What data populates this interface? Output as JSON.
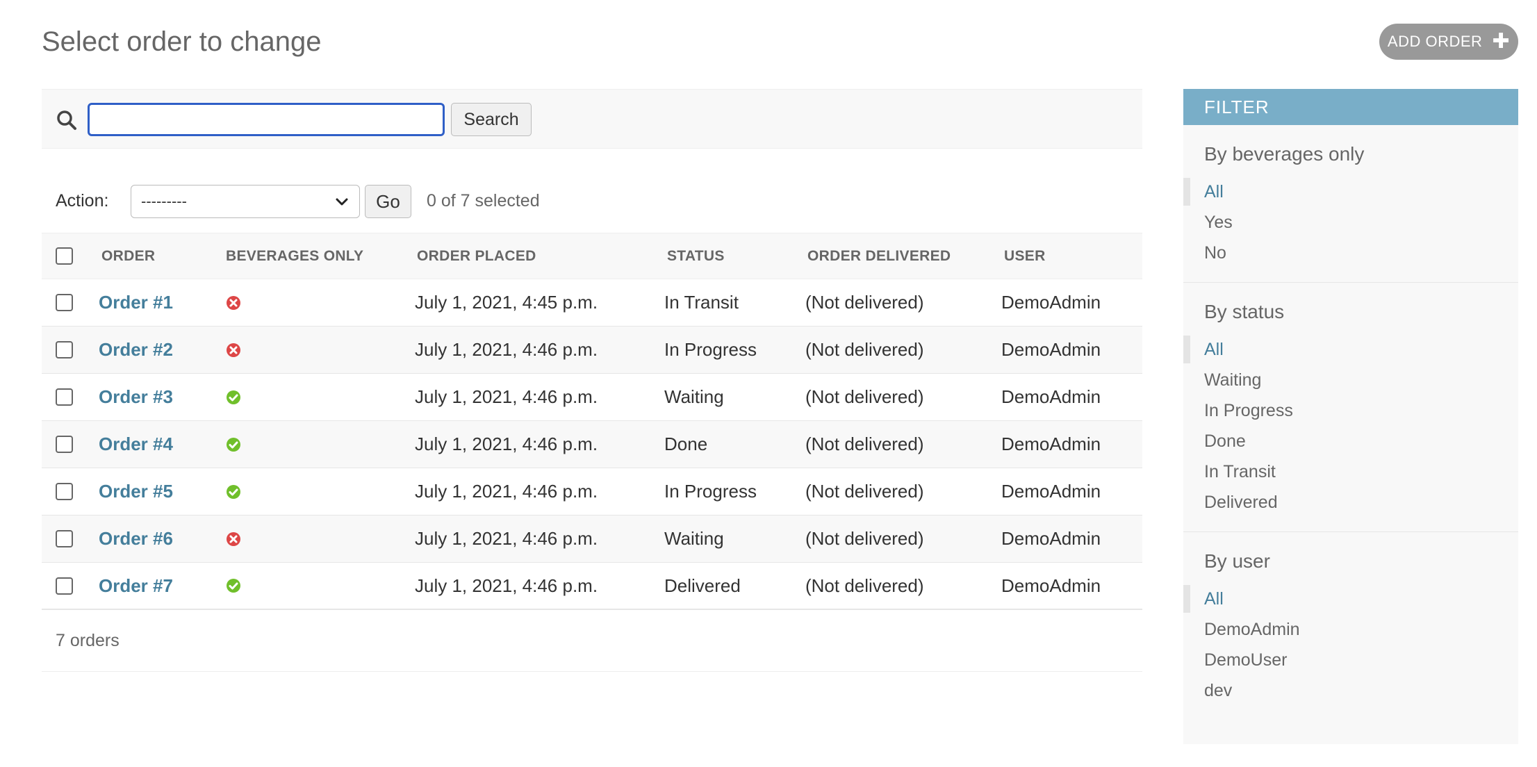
{
  "page": {
    "title": "Select order to change",
    "add_button_label": "ADD ORDER",
    "add_icon": "plus-icon"
  },
  "search": {
    "value": "",
    "placeholder": "",
    "button_label": "Search",
    "icon": "search-icon"
  },
  "actions": {
    "label": "Action:",
    "selected_option": "---------",
    "go_label": "Go",
    "counter": "0 of 7 selected"
  },
  "table": {
    "headers": {
      "order": "ORDER",
      "beverages_only": "BEVERAGES ONLY",
      "order_placed": "ORDER PLACED",
      "status": "STATUS",
      "order_delivered": "ORDER DELIVERED",
      "user": "USER"
    },
    "rows": [
      {
        "order": "Order #1",
        "beverages_only": false,
        "order_placed": "July 1, 2021, 4:45 p.m.",
        "status": "In Transit",
        "order_delivered": "(Not delivered)",
        "user": "DemoAdmin"
      },
      {
        "order": "Order #2",
        "beverages_only": false,
        "order_placed": "July 1, 2021, 4:46 p.m.",
        "status": "In Progress",
        "order_delivered": "(Not delivered)",
        "user": "DemoAdmin"
      },
      {
        "order": "Order #3",
        "beverages_only": true,
        "order_placed": "July 1, 2021, 4:46 p.m.",
        "status": "Waiting",
        "order_delivered": "(Not delivered)",
        "user": "DemoAdmin"
      },
      {
        "order": "Order #4",
        "beverages_only": true,
        "order_placed": "July 1, 2021, 4:46 p.m.",
        "status": "Done",
        "order_delivered": "(Not delivered)",
        "user": "DemoAdmin"
      },
      {
        "order": "Order #5",
        "beverages_only": true,
        "order_placed": "July 1, 2021, 4:46 p.m.",
        "status": "In Progress",
        "order_delivered": "(Not delivered)",
        "user": "DemoAdmin"
      },
      {
        "order": "Order #6",
        "beverages_only": false,
        "order_placed": "July 1, 2021, 4:46 p.m.",
        "status": "Waiting",
        "order_delivered": "(Not delivered)",
        "user": "DemoAdmin"
      },
      {
        "order": "Order #7",
        "beverages_only": true,
        "order_placed": "July 1, 2021, 4:46 p.m.",
        "status": "Delivered",
        "order_delivered": "(Not delivered)",
        "user": "DemoAdmin"
      }
    ],
    "result_count": "7 orders"
  },
  "filter": {
    "title": "FILTER",
    "groups": [
      {
        "title": "By beverages only",
        "options": [
          "All",
          "Yes",
          "No"
        ],
        "selected": "All"
      },
      {
        "title": "By status",
        "options": [
          "All",
          "Waiting",
          "In Progress",
          "Done",
          "In Transit",
          "Delivered"
        ],
        "selected": "All"
      },
      {
        "title": "By user",
        "options": [
          "All",
          "DemoAdmin",
          "DemoUser",
          "dev"
        ],
        "selected": "All"
      }
    ]
  },
  "colors": {
    "link": "#447e9b",
    "filter_header": "#79aec8",
    "add_button": "#999999",
    "bool_true": "#70bf2b",
    "bool_false": "#dd4646",
    "search_focus": "#2f5fc7"
  }
}
